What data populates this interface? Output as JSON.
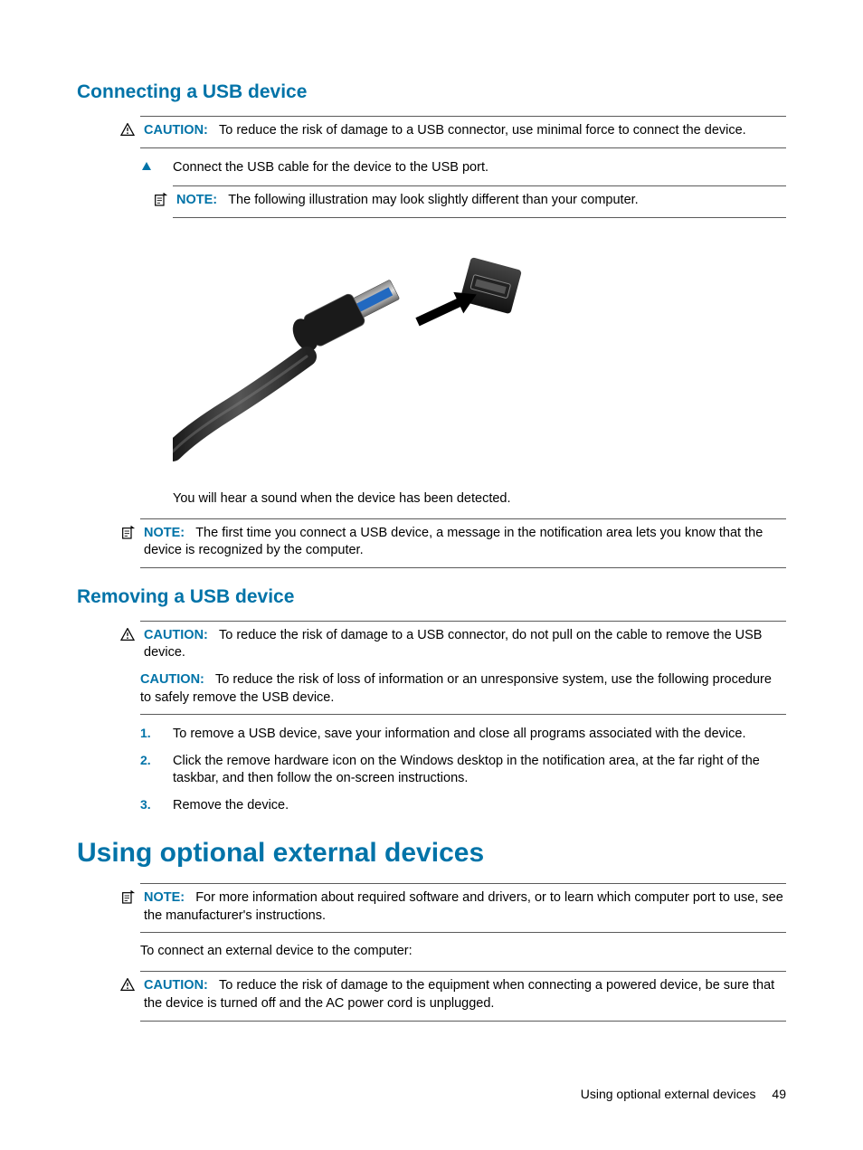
{
  "section1": {
    "title": "Connecting a USB device",
    "caution": {
      "label": "CAUTION:",
      "text": "To reduce the risk of damage to a USB connector, use minimal force to connect the device."
    },
    "step1": "Connect the USB cable for the device to the USB port.",
    "nestedNote": {
      "label": "NOTE:",
      "text": "The following illustration may look slightly different than your computer."
    },
    "afterImage": "You will hear a sound when the device has been detected.",
    "note2": {
      "label": "NOTE:",
      "text": "The first time you connect a USB device, a message in the notification area lets you know that the device is recognized by the computer."
    }
  },
  "section2": {
    "title": "Removing a USB device",
    "caution1": {
      "label": "CAUTION:",
      "text": "To reduce the risk of damage to a USB connector, do not pull on the cable to remove the USB device."
    },
    "caution2": {
      "label": "CAUTION:",
      "text": "To reduce the risk of loss of information or an unresponsive system, use the following procedure to safely remove the USB device."
    },
    "steps": [
      {
        "num": "1.",
        "text": "To remove a USB device, save your information and close all programs associated with the device."
      },
      {
        "num": "2.",
        "text": "Click the remove hardware icon on the Windows desktop in the notification area, at the far right of the taskbar, and then follow the on-screen instructions."
      },
      {
        "num": "3.",
        "text": "Remove the device."
      }
    ]
  },
  "section3": {
    "title": "Using optional external devices",
    "note": {
      "label": "NOTE:",
      "text": "For more information about required software and drivers, or to learn which computer port to use, see the manufacturer's instructions."
    },
    "intro": "To connect an external device to the computer:",
    "caution": {
      "label": "CAUTION:",
      "text": "To reduce the risk of damage to the equipment when connecting a powered device, be sure that the device is turned off and the AC power cord is unplugged."
    }
  },
  "footer": {
    "text": "Using optional external devices",
    "page": "49"
  }
}
